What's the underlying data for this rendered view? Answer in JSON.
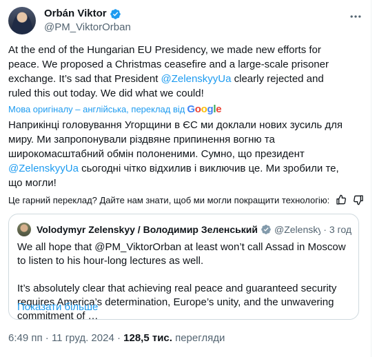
{
  "author": {
    "name": "Orbán Viktor",
    "handle": "@PM_ViktorOrban"
  },
  "post": {
    "text_before_mention": "At the end of the Hungarian EU Presidency, we made new efforts for peace. We proposed a Christmas ceasefire and a large-scale prisoner exchange. It’s sad that President ",
    "mention": "@ZelenskyyUa",
    "text_after_mention": " clearly rejected and ruled this out today. We did what we could!"
  },
  "translation": {
    "source_label": "Мова оригіналу – англійська, переклад від",
    "provider": "Google",
    "text_before_mention": "Наприкінці головування Угорщини в ЄС ми доклали нових зусиль для миру. Ми запропонували різдвяне припинення вогню та широкомасштабний обмін полоненими. Сумно, що президент ",
    "mention": "@ZelenskyyUa",
    "text_after_mention": " сьогодні чітко відхилив і виключив це. Ми зробили те, що могли!",
    "feedback_prompt": "Це гарний переклад? Дайте нам знати, щоб ми могли покращити технологію:"
  },
  "quote": {
    "name": "Volodymyr Zelenskyy / Володимир Зеленський",
    "handle": "@ZelenskyyUa",
    "dot": "·",
    "time": "3 год",
    "paragraph1": "We all hope that @PM_ViktorOrban at least won’t call Assad in Moscow to listen to his hour-long lectures as well.",
    "paragraph2": "It’s absolutely clear that achieving real peace and guaranteed security requires America’s determination, Europe’s unity, and the unwavering commitment of …",
    "show_more": "Показати більше"
  },
  "meta": {
    "time": "6:49 пп",
    "dot1": "·",
    "date": "11 груд. 2024",
    "dot2": "·",
    "views_count": "128,5 тис.",
    "views_label": "перегляди"
  },
  "icons": {
    "verified": "verified-badge-icon",
    "more": "more-options-icon",
    "thumb_up": "thumbs-up-icon",
    "thumb_down": "thumbs-down-icon"
  },
  "colors": {
    "link": "#1d9bf0",
    "secondary_text": "#536471",
    "primary_text": "#0f1419",
    "border": "#cfd9de"
  }
}
